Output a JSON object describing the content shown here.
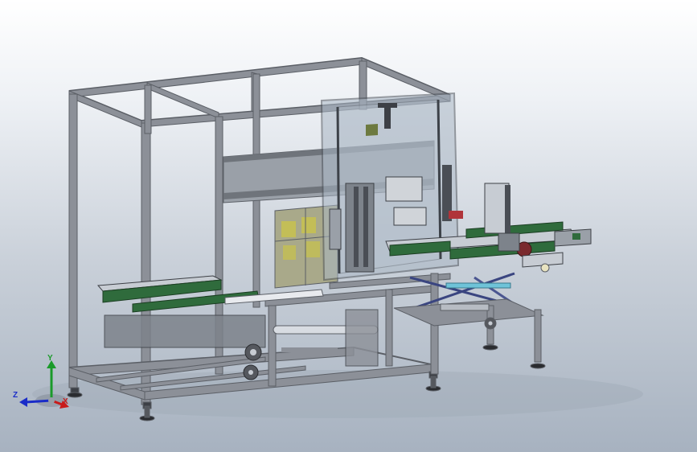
{
  "viewport": {
    "background_top": "#ffffff",
    "background_bottom": "#a7b2c0"
  },
  "model": {
    "frame_color": "#8c9098",
    "frame_shadow": "#5b5f66",
    "guard_color": "#a9b6c4",
    "conveyor_green": "#2f6b3c",
    "label_panel_color": "#b3b27a"
  },
  "triad": {
    "x_label": "X",
    "y_label": "Y",
    "z_label": "Z",
    "x_color": "#c81a1a",
    "y_color": "#1a9a2a",
    "z_color": "#1a2cc8"
  }
}
